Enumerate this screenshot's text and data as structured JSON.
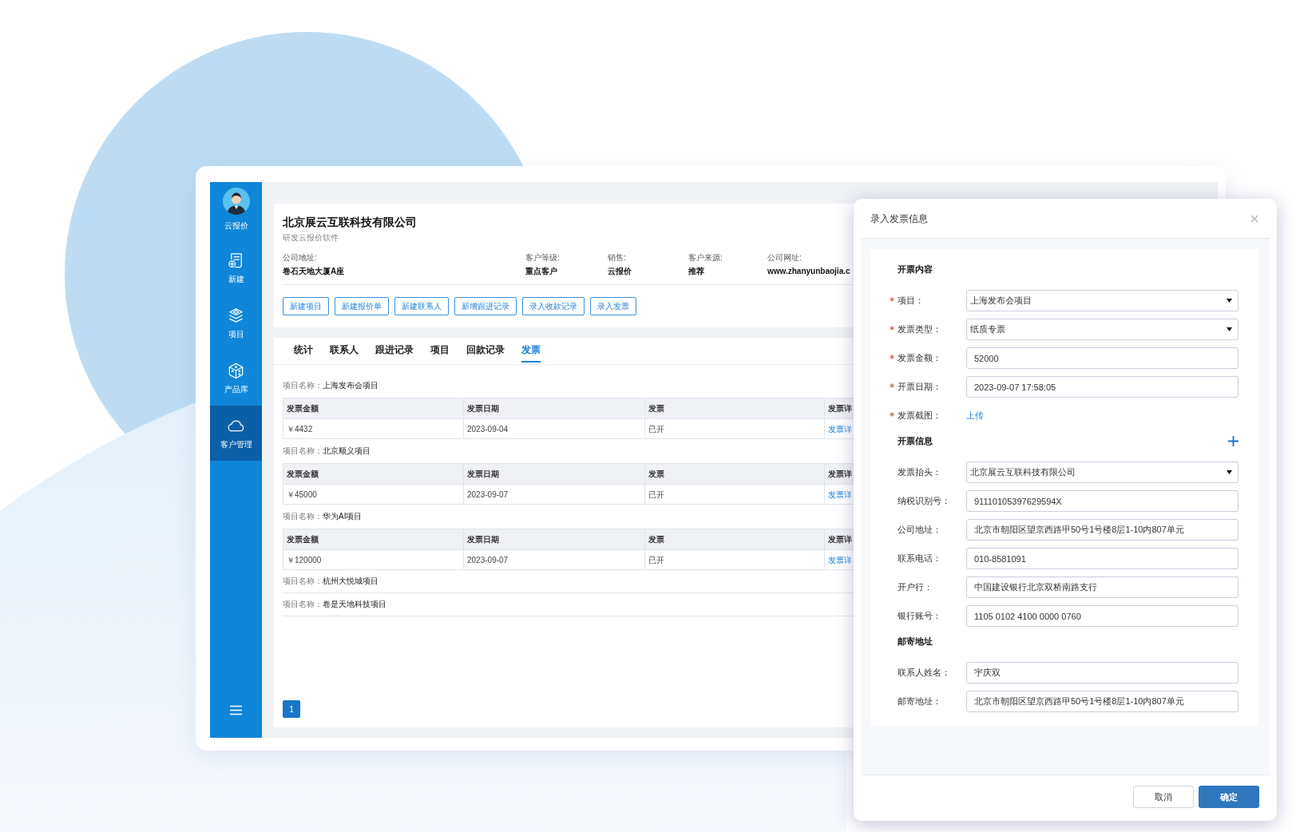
{
  "sidebar": {
    "profile": {
      "label": "云报价"
    },
    "items": [
      {
        "label": "新建",
        "selected": false
      },
      {
        "label": "项目",
        "selected": false
      },
      {
        "label": "产品库",
        "selected": false
      },
      {
        "label": "客户管理",
        "selected": true
      }
    ]
  },
  "company": {
    "name": "北京展云互联科技有限公司",
    "subtitle": "研发云报价软件",
    "fields": [
      {
        "label": "公司地址:",
        "value": "卷石天地大厦A座"
      },
      {
        "label": "客户等级:",
        "value": "重点客户"
      },
      {
        "label": "销售:",
        "value": "云报价"
      },
      {
        "label": "客户来源:",
        "value": "推荐"
      },
      {
        "label": "公司网址:",
        "value": "www.zhanyunbaojia.c"
      }
    ],
    "actions": [
      "新建项目",
      "新建报价单",
      "新建联系人",
      "新增跟进记录",
      "录入收款记录",
      "录入发票"
    ]
  },
  "tabs": [
    {
      "label": "统计",
      "selected": false
    },
    {
      "label": "联系人",
      "selected": false
    },
    {
      "label": "跟进记录",
      "selected": false
    },
    {
      "label": "项目",
      "selected": false
    },
    {
      "label": "回款记录",
      "selected": false
    },
    {
      "label": "发票",
      "selected": true
    }
  ],
  "invoice_groups": [
    {
      "project_label": "项目名称：",
      "project_name": "上海发布会项目",
      "columns": [
        "发票金额",
        "发票日期",
        "发票",
        "发票详"
      ],
      "rows": [
        {
          "amount": "￥4432",
          "date": "2023-09-04",
          "status": "已开",
          "detail": "发票详"
        }
      ]
    },
    {
      "project_label": "项目名称：",
      "project_name": "北京顺义项目",
      "columns": [
        "发票金额",
        "发票日期",
        "发票",
        "发票详"
      ],
      "rows": [
        {
          "amount": "￥45000",
          "date": "2023-09-07",
          "status": "已开",
          "detail": "发票详"
        }
      ]
    },
    {
      "project_label": "项目名称：",
      "project_name": "华为AI项目",
      "columns": [
        "发票金额",
        "发票日期",
        "发票",
        "发票详"
      ],
      "rows": [
        {
          "amount": "￥120000",
          "date": "2023-09-07",
          "status": "已开",
          "detail": "发票详"
        }
      ]
    },
    {
      "project_label": "项目名称：",
      "project_name": "杭州大悦城项目"
    },
    {
      "project_label": "项目名称：",
      "project_name": "卷是天地科技项目"
    }
  ],
  "pagination": [
    {
      "label": "1",
      "selected": true
    }
  ],
  "dialog": {
    "title": "录入发票信息",
    "sections": [
      {
        "title": "开票内容",
        "fields": [
          {
            "kind": "select",
            "label": "项目：",
            "required": true,
            "value": "上海发布会项目"
          },
          {
            "kind": "select",
            "label": "发票类型：",
            "required": true,
            "value": "纸质专票"
          },
          {
            "kind": "input",
            "label": "发票金额：",
            "required": true,
            "value": "52000"
          },
          {
            "kind": "input",
            "label": "开票日期：",
            "required": true,
            "value": "2023-09-07 17:58:05"
          },
          {
            "kind": "upload",
            "label": "发票截图：",
            "required": true,
            "value": "上传"
          }
        ]
      },
      {
        "title": "开票信息",
        "add_button": true,
        "fields": [
          {
            "kind": "select",
            "label": "发票抬头：",
            "required": false,
            "value": "北京展云互联科技有限公司"
          },
          {
            "kind": "input",
            "label": "纳税识别号：",
            "required": false,
            "value": "91110105397629594X"
          },
          {
            "kind": "input",
            "label": "公司地址：",
            "required": false,
            "value": "北京市朝阳区望京西路甲50号1号楼8层1-10内807单元"
          },
          {
            "kind": "input",
            "label": "联系电话：",
            "required": false,
            "value": "010-8581091"
          },
          {
            "kind": "input",
            "label": "开户行：",
            "required": false,
            "value": "中国建设银行北京双桥南路支行"
          },
          {
            "kind": "input",
            "label": "银行账号：",
            "required": false,
            "value": "1105 0102 4100 0000 0760"
          }
        ]
      },
      {
        "title": "邮寄地址",
        "fields": [
          {
            "kind": "input",
            "label": "联系人姓名：",
            "required": false,
            "value": "宇庆双"
          },
          {
            "kind": "input",
            "label": "邮寄地址：",
            "required": false,
            "value": "北京市朝阳区望京西路甲50号1号楼8层1-10内807单元"
          }
        ]
      }
    ],
    "buttons": [
      {
        "label": "取消",
        "primary": false
      },
      {
        "label": "确定",
        "primary": true
      }
    ]
  }
}
